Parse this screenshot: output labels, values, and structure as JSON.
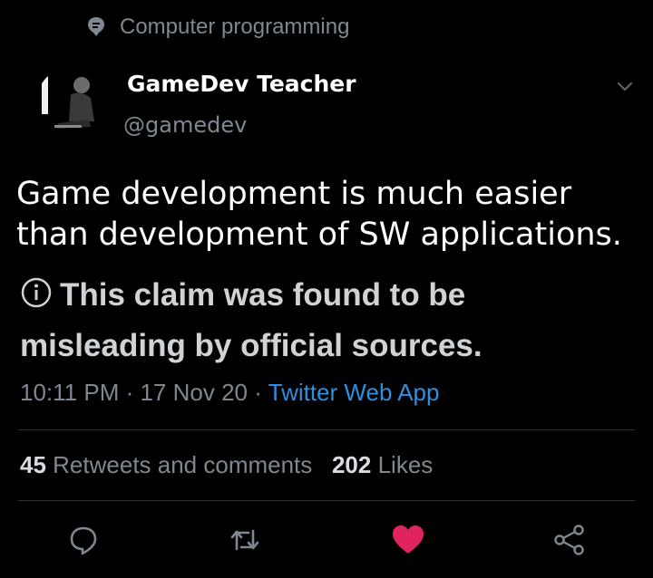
{
  "topic": {
    "label": "Computer programming",
    "icon": "topic-pin-icon"
  },
  "author": {
    "name": "GameDev Teacher",
    "handle": "@gamedev"
  },
  "tweet": {
    "line1": "Game development is much easier",
    "line2": "than development of SW applications."
  },
  "claim": {
    "line1": "This claim was found to be",
    "line2": "misleading by official sources."
  },
  "meta": {
    "time": "10:11 PM",
    "date": "17 Nov 20",
    "app": "Twitter Web App",
    "separator": " · "
  },
  "stats": {
    "retweets_count": "45",
    "retweets_label": "Retweets and comments",
    "likes_count": "202",
    "likes_label": "Likes"
  },
  "colors": {
    "background": "#000000",
    "muted": "#7f8790",
    "link": "#2f8fdf",
    "like": "#e0245e"
  },
  "actions": [
    "reply-icon",
    "retweet-icon",
    "like-icon",
    "share-icon"
  ]
}
